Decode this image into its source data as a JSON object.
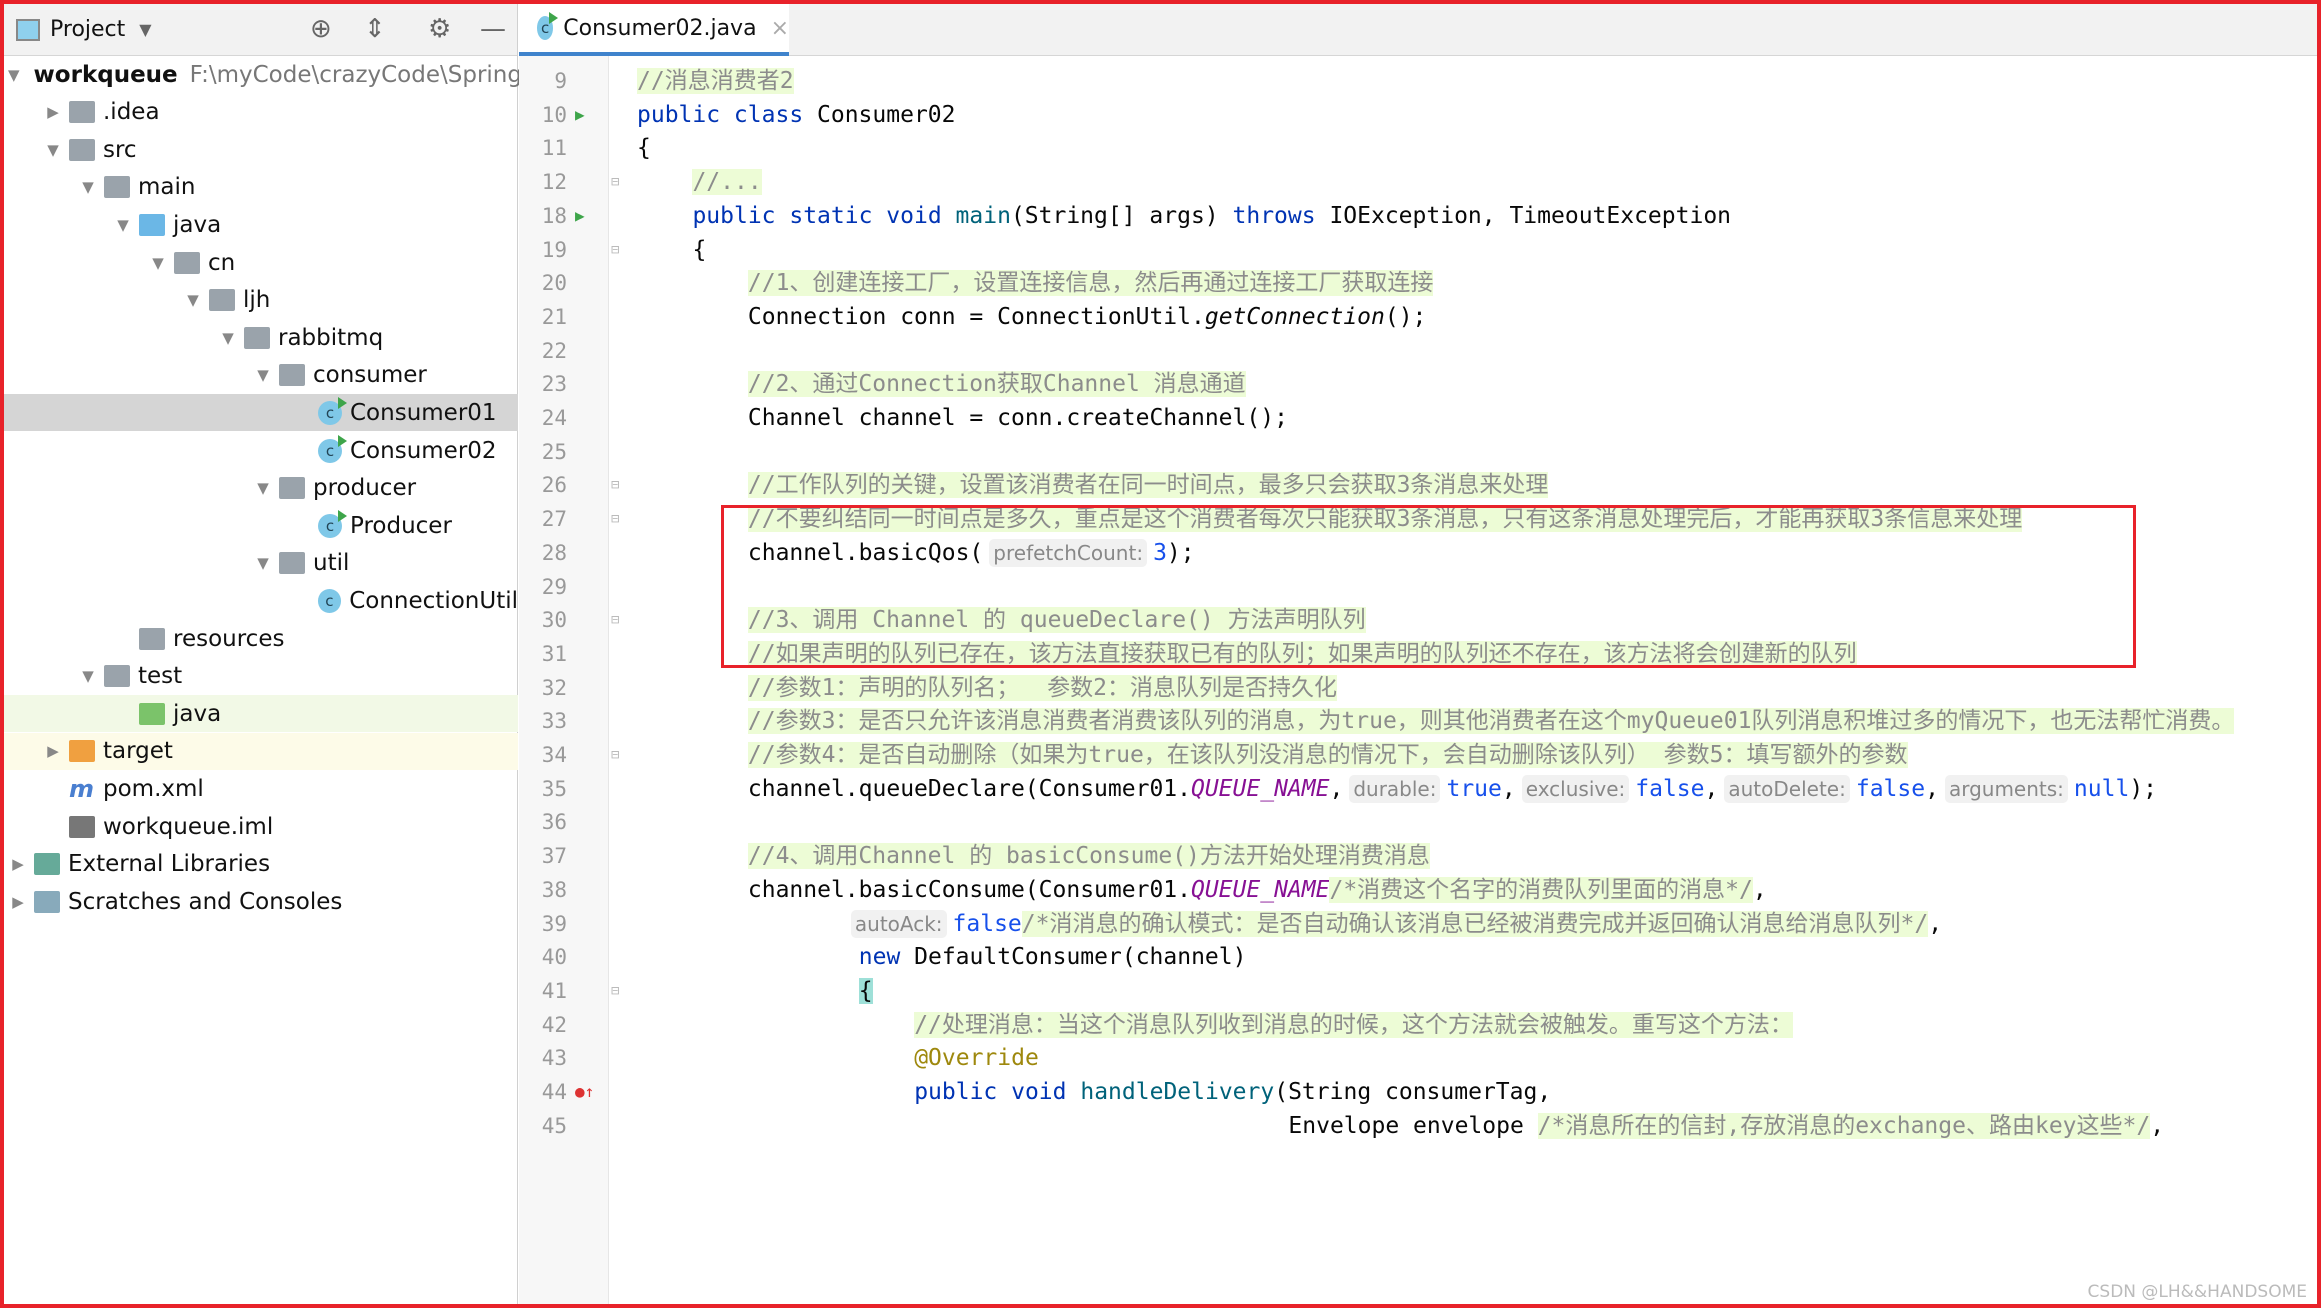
{
  "sidebar": {
    "title": "Project",
    "icons": [
      "locate-icon",
      "collapse-all-icon",
      "gear-icon",
      "minimize-icon"
    ],
    "tree": [
      {
        "label": "workqueue",
        "path": "F:\\myCode\\crazyCode\\Spring",
        "level": 0,
        "arrow": "open",
        "icon": "module",
        "bold": true
      },
      {
        "label": ".idea",
        "level": 1,
        "arrow": "closed",
        "icon": "folder"
      },
      {
        "label": "src",
        "level": 1,
        "arrow": "open",
        "icon": "folder"
      },
      {
        "label": "main",
        "level": 2,
        "arrow": "open",
        "icon": "folder"
      },
      {
        "label": "java",
        "level": 3,
        "arrow": "open",
        "icon": "src-folder"
      },
      {
        "label": "cn",
        "level": 4,
        "arrow": "open",
        "icon": "package"
      },
      {
        "label": "ljh",
        "level": 5,
        "arrow": "open",
        "icon": "package"
      },
      {
        "label": "rabbitmq",
        "level": 6,
        "arrow": "open",
        "icon": "package"
      },
      {
        "label": "consumer",
        "level": 7,
        "arrow": "open",
        "icon": "package"
      },
      {
        "label": "Consumer01",
        "level": 8,
        "icon": "class-run",
        "selected": true
      },
      {
        "label": "Consumer02",
        "level": 8,
        "icon": "class-run"
      },
      {
        "label": "producer",
        "level": 7,
        "arrow": "open",
        "icon": "package"
      },
      {
        "label": "Producer",
        "level": 8,
        "icon": "class-run"
      },
      {
        "label": "util",
        "level": 7,
        "arrow": "open",
        "icon": "package"
      },
      {
        "label": "ConnectionUtil",
        "level": 8,
        "icon": "class"
      },
      {
        "label": "resources",
        "level": 3,
        "icon": "resources-folder"
      },
      {
        "label": "test",
        "level": 2,
        "arrow": "open",
        "icon": "folder"
      },
      {
        "label": "java",
        "level": 3,
        "icon": "test-folder",
        "highlight": "#f2f9e6"
      },
      {
        "label": "target",
        "level": 1,
        "arrow": "closed",
        "icon": "excluded-folder",
        "highlight": "#fdfbe8"
      },
      {
        "label": "pom.xml",
        "level": 1,
        "icon": "maven"
      },
      {
        "label": "workqueue.iml",
        "level": 1,
        "icon": "iml"
      },
      {
        "label": "External Libraries",
        "level": 0,
        "arrow": "closed",
        "icon": "libraries"
      },
      {
        "label": "Scratches and Consoles",
        "level": 0,
        "arrow": "closed",
        "icon": "scratches"
      }
    ]
  },
  "editor": {
    "tab": {
      "label": "Consumer02.java",
      "icon": "c",
      "close": "×"
    },
    "lines": [
      {
        "n": "9",
        "i": 0,
        "tk": [
          [
            "c",
            "//消息消费者2"
          ]
        ]
      },
      {
        "n": "10",
        "i": 0,
        "g": "run",
        "tk": [
          [
            "k",
            "public class"
          ],
          [
            "t",
            " Consumer02"
          ]
        ]
      },
      {
        "n": "11",
        "i": 0,
        "tk": [
          [
            "t",
            "{"
          ]
        ]
      },
      {
        "n": "12",
        "i": 4,
        "g": "fold",
        "tk": [
          [
            "c",
            "//..."
          ]
        ]
      },
      {
        "n": "18",
        "i": 4,
        "g": "run",
        "tk": [
          [
            "k",
            "public static void "
          ],
          [
            "m",
            "main"
          ],
          [
            "t",
            "(String[] args) "
          ],
          [
            "k",
            "throws"
          ],
          [
            "t",
            " IOException, TimeoutException"
          ]
        ]
      },
      {
        "n": "19",
        "i": 4,
        "g": "fold",
        "tk": [
          [
            "t",
            "{"
          ]
        ]
      },
      {
        "n": "20",
        "i": 8,
        "tk": [
          [
            "c",
            "//1、创建连接工厂，设置连接信息，然后再通过连接工厂获取连接"
          ]
        ]
      },
      {
        "n": "21",
        "i": 8,
        "tk": [
          [
            "t",
            "Connection conn = ConnectionUtil."
          ],
          [
            "i",
            "getConnection"
          ],
          [
            "t",
            "();"
          ]
        ]
      },
      {
        "n": "22",
        "i": 0,
        "tk": []
      },
      {
        "n": "23",
        "i": 8,
        "tk": [
          [
            "c",
            "//2、通过Connection获取Channel 消息通道"
          ]
        ]
      },
      {
        "n": "24",
        "i": 8,
        "tk": [
          [
            "t",
            "Channel channel = conn.createChannel();"
          ]
        ]
      },
      {
        "n": "25",
        "i": 0,
        "tk": []
      },
      {
        "n": "26",
        "i": 8,
        "g": "fold",
        "tk": [
          [
            "c",
            "//工作队列的关键，设置该消费者在同一时间点，最多只会获取3条消息来处理"
          ]
        ]
      },
      {
        "n": "27",
        "i": 8,
        "g": "fold",
        "tk": [
          [
            "c",
            "//不要纠结同一时间点是多久，重点是这个消费者每次只能获取3条消息，只有这条消息处理完后，才能再获取3条信息来处理"
          ]
        ]
      },
      {
        "n": "28",
        "i": 8,
        "tk": [
          [
            "t",
            "channel.basicQos("
          ],
          [
            "h",
            "prefetchCount:"
          ],
          [
            "n",
            "3"
          ],
          [
            "t",
            ");"
          ]
        ]
      },
      {
        "n": "29",
        "i": 0,
        "tk": []
      },
      {
        "n": "30",
        "i": 8,
        "g": "fold",
        "tk": [
          [
            "c",
            "//3、调用 Channel 的 queueDeclare() 方法声明队列"
          ]
        ]
      },
      {
        "n": "31",
        "i": 8,
        "tk": [
          [
            "c",
            "//如果声明的队列已存在，该方法直接获取已有的队列；如果声明的队列还不存在，该方法将会创建新的队列"
          ]
        ]
      },
      {
        "n": "32",
        "i": 8,
        "tk": [
          [
            "c",
            "//参数1：声明的队列名；  参数2：消息队列是否持久化"
          ]
        ]
      },
      {
        "n": "33",
        "i": 8,
        "tk": [
          [
            "c",
            "//参数3：是否只允许该消息消费者消费该队列的消息，为true，则其他消费者在这个myQueue01队列消息积堆过多的情况下，也无法帮忙消费。"
          ]
        ]
      },
      {
        "n": "34",
        "i": 8,
        "g": "fold",
        "tk": [
          [
            "c",
            "//参数4：是否自动删除（如果为true，在该队列没消息的情况下，会自动删除该队列） 参数5：填写额外的参数"
          ]
        ]
      },
      {
        "n": "35",
        "i": 8,
        "tk": [
          [
            "t",
            "channel.queueDeclare(Consumer01."
          ],
          [
            "s",
            "QUEUE_NAME"
          ],
          [
            "t",
            ","
          ],
          [
            "h",
            "durable:"
          ],
          [
            "n",
            "true"
          ],
          [
            "t",
            ","
          ],
          [
            "h",
            "exclusive:"
          ],
          [
            "n",
            "false"
          ],
          [
            "t",
            ","
          ],
          [
            "h",
            "autoDelete:"
          ],
          [
            "n",
            "false"
          ],
          [
            "t",
            ","
          ],
          [
            "h",
            "arguments:"
          ],
          [
            "n",
            "null"
          ],
          [
            "t",
            ");"
          ]
        ]
      },
      {
        "n": "36",
        "i": 0,
        "tk": []
      },
      {
        "n": "37",
        "i": 8,
        "tk": [
          [
            "c",
            "//4、调用Channel 的 basicConsume()方法开始处理消费消息"
          ]
        ]
      },
      {
        "n": "38",
        "i": 8,
        "tk": [
          [
            "t",
            "channel.basicConsume(Consumer01."
          ],
          [
            "s",
            "QUEUE_NAME"
          ],
          [
            "c",
            "/*消费这个名字的消费队列里面的消息*/"
          ],
          [
            "t",
            ","
          ]
        ]
      },
      {
        "n": "39",
        "i": 15,
        "tk": [
          [
            "h",
            "autoAck:"
          ],
          [
            "n",
            "false"
          ],
          [
            "c",
            "/*消消息的确认模式：是否自动确认该消息已经被消费完成并返回确认消息给消息队列*/"
          ],
          [
            "t",
            ","
          ]
        ]
      },
      {
        "n": "40",
        "i": 16,
        "tk": [
          [
            "k",
            "new"
          ],
          [
            "t",
            " DefaultConsumer(channel)"
          ]
        ]
      },
      {
        "n": "41",
        "i": 16,
        "g": "fold",
        "tk": [
          [
            "b",
            "{"
          ]
        ]
      },
      {
        "n": "42",
        "i": 20,
        "tk": [
          [
            "c",
            "//处理消息：当这个消息队列收到消息的时候，这个方法就会被触发。重写这个方法："
          ]
        ]
      },
      {
        "n": "43",
        "i": 20,
        "tk": [
          [
            "a",
            "@Override"
          ]
        ]
      },
      {
        "n": "44",
        "i": 20,
        "g": "override",
        "tk": [
          [
            "k",
            "public void "
          ],
          [
            "m",
            "handleDelivery"
          ],
          [
            "t",
            "(String consumerTag,"
          ]
        ]
      },
      {
        "n": "45",
        "i": 47,
        "tk": [
          [
            "t",
            "Envelope envelope "
          ],
          [
            "c",
            "/*消息所在的信封,存放消息的exchange、路由key这些*/"
          ],
          [
            "t",
            ","
          ]
        ]
      }
    ]
  },
  "watermark": "CSDN @LH&&HANDSOME",
  "colors": {
    "annotation_box": "#e8222a",
    "comment_bg": "#edfcd6",
    "keyword": "#0033b3"
  }
}
